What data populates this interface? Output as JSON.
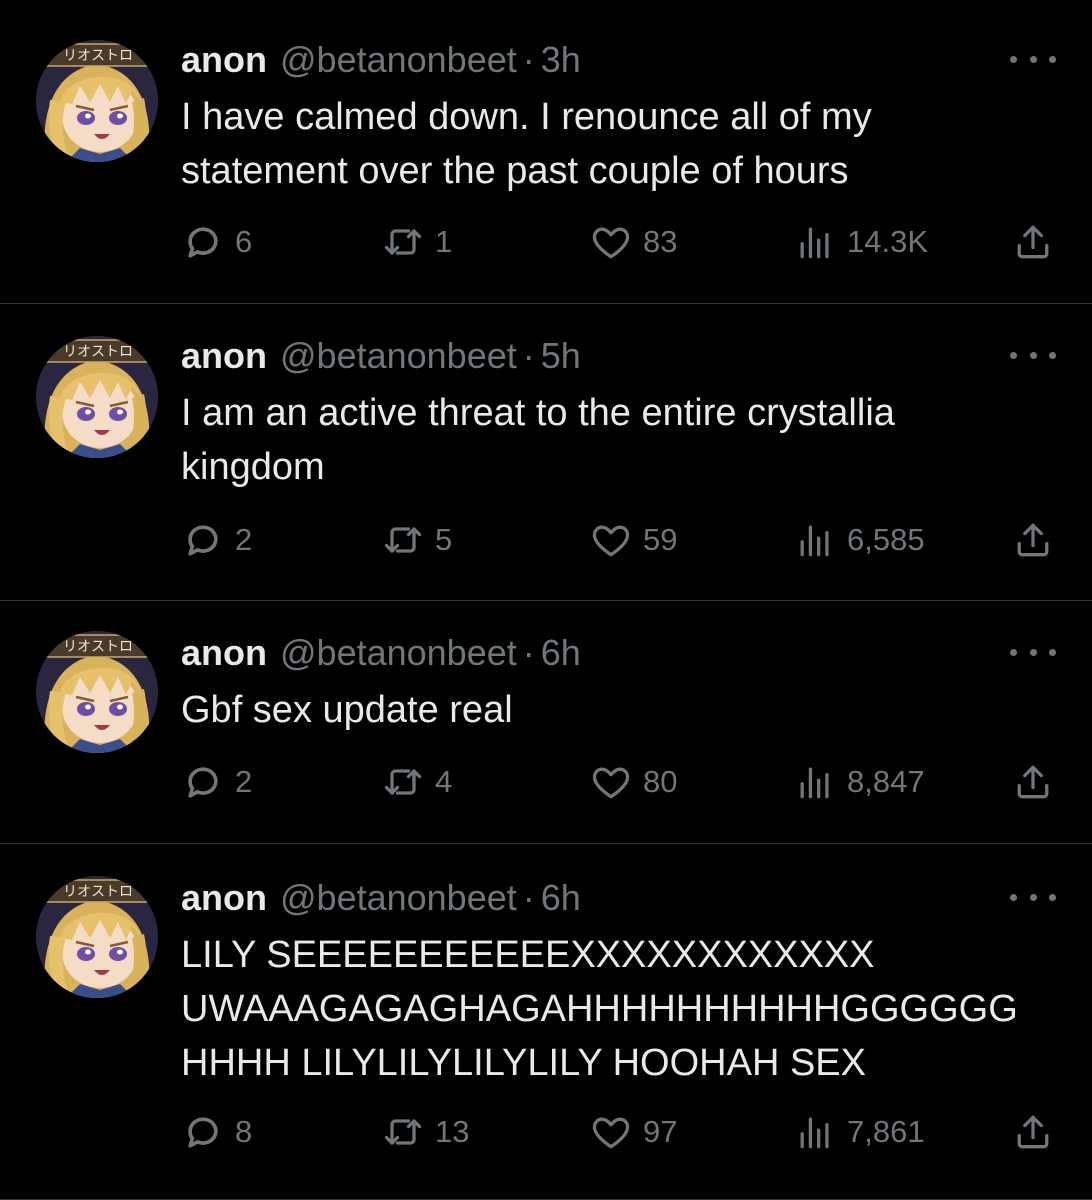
{
  "tweets": [
    {
      "name": "anon",
      "handle": "@betanonbeet",
      "separator": "·",
      "time": "3h",
      "text": "I have calmed down. I renounce all of my\nstatement over the past couple of hours",
      "replies": "6",
      "reposts": "1",
      "likes": "83",
      "views": "14.3K",
      "avatar_banner": "リオストロ"
    },
    {
      "name": "anon",
      "handle": "@betanonbeet",
      "separator": "·",
      "time": "5h",
      "text": "I am an active threat to the entire crystallia\nkingdom",
      "replies": "2",
      "reposts": "5",
      "likes": "59",
      "views": "6,585",
      "avatar_banner": "リオストロ"
    },
    {
      "name": "anon",
      "handle": "@betanonbeet",
      "separator": "·",
      "time": "6h",
      "text": "Gbf sex update real",
      "replies": "2",
      "reposts": "4",
      "likes": "80",
      "views": "8,847",
      "avatar_banner": "リオストロ"
    },
    {
      "name": "anon",
      "handle": "@betanonbeet",
      "separator": "·",
      "time": "6h",
      "text": "LILY SEEEEEEEEEEEXXXXXXXXXXXX\nUWAAAGAGAGHAGAHHHHHHHHHHGGGGGG\nHHHH LILYLILYLILYLILY HOOHAH SEX",
      "replies": "8",
      "reposts": "13",
      "likes": "97",
      "views": "7,861",
      "avatar_banner": "リオストロ"
    }
  ],
  "icons": {
    "reply": "reply-icon",
    "repost": "repost-icon",
    "like": "heart-icon",
    "views": "views-icon",
    "share": "share-icon",
    "more": "more-icon"
  },
  "colors": {
    "background": "#000000",
    "primary_text": "#e7e9ea",
    "secondary_text": "#71767b",
    "divider": "#2f3336"
  }
}
